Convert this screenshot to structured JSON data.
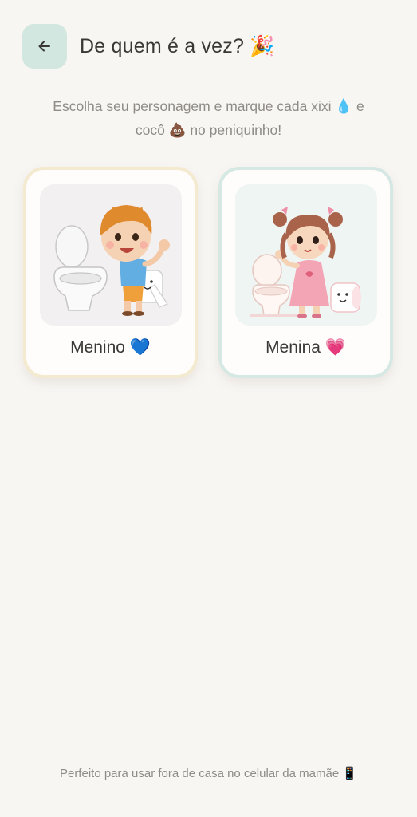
{
  "header": {
    "title": "De quem é a vez? 🎉"
  },
  "subtitle": {
    "line1": "Escolha seu personagem e marque cada xixi 💧 e",
    "line2": "cocô 💩 no peniquinho!"
  },
  "cards": [
    {
      "label": "Menino 💙",
      "character": "boy-character-illustration"
    },
    {
      "label": "Menina 💗",
      "character": "girl-character-illustration"
    }
  ],
  "footer": {
    "text": "Perfeito para usar fora de casa no celular da mamãe 📱"
  },
  "colors": {
    "background": "#f8f6f3",
    "back_button_bg": "#d3e7e1",
    "boy_card_border": "#f3ead0",
    "girl_card_border": "#d6e8e3",
    "muted_text": "#8f8b85"
  }
}
